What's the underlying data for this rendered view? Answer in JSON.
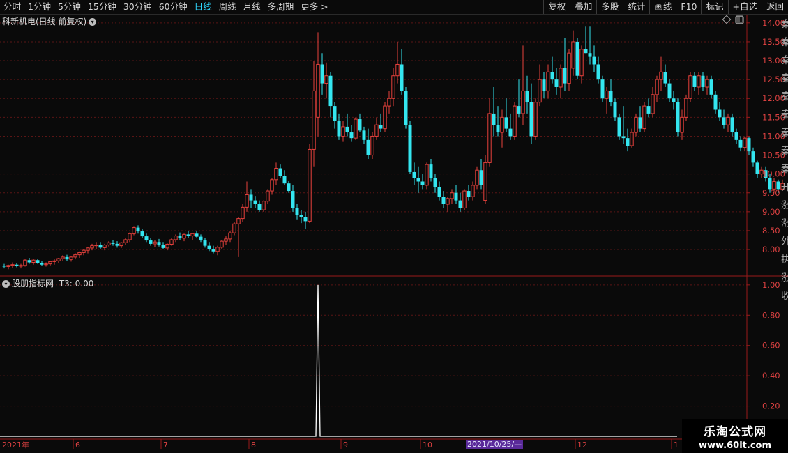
{
  "toolbar": {
    "left_items": [
      "分时",
      "1分钟",
      "5分钟",
      "15分钟",
      "30分钟",
      "60分钟",
      "日线",
      "周线",
      "月线",
      "多周期",
      "更多 >"
    ],
    "active": "日线",
    "right_items": [
      "复权",
      "叠加",
      "多股",
      "统计",
      "画线",
      "F10",
      "标记",
      "+自选",
      "返回"
    ]
  },
  "main_panel": {
    "title": "科新机电(日线 前复权)",
    "ylim": [
      7.3,
      14.2
    ]
  },
  "indicator_panel": {
    "title": "股朋指标网",
    "readout": "T3: 0.00",
    "ylim": [
      0,
      1.05
    ]
  },
  "x_axis": {
    "year_label": "2021年",
    "months": [
      "6",
      "7",
      "8",
      "9",
      "10",
      "12",
      "1"
    ],
    "cursor_date": "2021/10/25/—"
  },
  "watermark": {
    "line1": "乐淘公式网",
    "line2": "www.60lt.com"
  },
  "edge_chars": "秦秦秦秦秦秦秦秦秦开涨涨外执涨收",
  "colors": {
    "up": "#e8413c",
    "down": "#34e6f0",
    "axis": "#9a1a1a",
    "grid": "#5a1515",
    "line": "#ffffff"
  },
  "chart_data": [
    {
      "type": "candlestick",
      "title": "科新机电(日线 前复权)",
      "y_ticks": [
        8.0,
        8.5,
        9.0,
        9.5,
        10.0,
        10.5,
        11.0,
        11.5,
        12.0,
        12.5,
        13.0,
        13.5,
        14.0
      ],
      "ylim": [
        7.3,
        14.2
      ],
      "ohlc": [
        [
          7.57,
          7.62,
          7.5,
          7.55
        ],
        [
          7.55,
          7.6,
          7.48,
          7.58
        ],
        [
          7.58,
          7.66,
          7.52,
          7.6
        ],
        [
          7.6,
          7.65,
          7.53,
          7.56
        ],
        [
          7.56,
          7.62,
          7.5,
          7.58
        ],
        [
          7.58,
          7.74,
          7.55,
          7.72
        ],
        [
          7.72,
          7.78,
          7.62,
          7.66
        ],
        [
          7.66,
          7.75,
          7.6,
          7.72
        ],
        [
          7.72,
          7.76,
          7.62,
          7.64
        ],
        [
          7.64,
          7.7,
          7.56,
          7.6
        ],
        [
          7.6,
          7.66,
          7.55,
          7.62
        ],
        [
          7.62,
          7.7,
          7.58,
          7.68
        ],
        [
          7.68,
          7.74,
          7.6,
          7.7
        ],
        [
          7.7,
          7.78,
          7.64,
          7.76
        ],
        [
          7.76,
          7.85,
          7.7,
          7.8
        ],
        [
          7.8,
          7.86,
          7.7,
          7.74
        ],
        [
          7.74,
          7.82,
          7.68,
          7.8
        ],
        [
          7.8,
          7.9,
          7.74,
          7.86
        ],
        [
          7.86,
          7.95,
          7.78,
          7.92
        ],
        [
          7.92,
          8.02,
          7.85,
          7.98
        ],
        [
          7.98,
          8.06,
          7.9,
          8.04
        ],
        [
          8.04,
          8.15,
          7.98,
          8.1
        ],
        [
          8.1,
          8.2,
          8.02,
          8.12
        ],
        [
          8.12,
          8.2,
          8.0,
          8.05
        ],
        [
          8.05,
          8.15,
          7.98,
          8.12
        ],
        [
          8.12,
          8.22,
          8.08,
          8.18
        ],
        [
          8.18,
          8.25,
          8.1,
          8.15
        ],
        [
          8.15,
          8.22,
          8.05,
          8.1
        ],
        [
          8.1,
          8.2,
          8.04,
          8.18
        ],
        [
          8.18,
          8.3,
          8.12,
          8.26
        ],
        [
          8.26,
          8.45,
          8.2,
          8.42
        ],
        [
          8.42,
          8.62,
          8.38,
          8.58
        ],
        [
          8.58,
          8.64,
          8.42,
          8.48
        ],
        [
          8.48,
          8.55,
          8.3,
          8.35
        ],
        [
          8.35,
          8.42,
          8.2,
          8.24
        ],
        [
          8.24,
          8.3,
          8.1,
          8.15
        ],
        [
          8.15,
          8.24,
          8.06,
          8.2
        ],
        [
          8.2,
          8.28,
          8.08,
          8.12
        ],
        [
          8.12,
          8.2,
          8.0,
          8.04
        ],
        [
          8.04,
          8.16,
          7.98,
          8.14
        ],
        [
          8.14,
          8.3,
          8.1,
          8.26
        ],
        [
          8.26,
          8.4,
          8.2,
          8.36
        ],
        [
          8.36,
          8.45,
          8.25,
          8.3
        ],
        [
          8.3,
          8.42,
          8.22,
          8.4
        ],
        [
          8.4,
          8.5,
          8.3,
          8.36
        ],
        [
          8.36,
          8.44,
          8.26,
          8.42
        ],
        [
          8.42,
          8.5,
          8.32,
          8.34
        ],
        [
          8.34,
          8.4,
          8.2,
          8.24
        ],
        [
          8.24,
          8.3,
          8.05,
          8.1
        ],
        [
          8.1,
          8.2,
          7.96,
          8.0
        ],
        [
          8.0,
          8.1,
          7.9,
          7.95
        ],
        [
          7.95,
          8.1,
          7.85,
          8.06
        ],
        [
          8.06,
          8.26,
          8.0,
          8.22
        ],
        [
          8.22,
          8.35,
          8.12,
          8.28
        ],
        [
          8.28,
          8.48,
          8.2,
          8.44
        ],
        [
          8.44,
          8.72,
          8.38,
          8.68
        ],
        [
          8.68,
          8.85,
          7.8,
          8.82
        ],
        [
          8.82,
          9.2,
          8.72,
          9.12
        ],
        [
          9.12,
          9.8,
          9.0,
          9.45
        ],
        [
          9.45,
          9.6,
          9.1,
          9.3
        ],
        [
          9.3,
          9.42,
          9.1,
          9.2
        ],
        [
          9.2,
          9.3,
          9.0,
          9.05
        ],
        [
          9.05,
          9.3,
          9.0,
          9.28
        ],
        [
          9.28,
          9.6,
          9.2,
          9.55
        ],
        [
          9.55,
          9.9,
          9.45,
          9.85
        ],
        [
          9.85,
          10.3,
          9.7,
          10.15
        ],
        [
          10.15,
          10.25,
          9.9,
          9.95
        ],
        [
          9.95,
          10.1,
          9.7,
          9.75
        ],
        [
          9.75,
          9.82,
          9.5,
          9.55
        ],
        [
          9.55,
          9.7,
          9.0,
          9.1
        ],
        [
          9.1,
          9.2,
          8.8,
          8.92
        ],
        [
          8.92,
          9.05,
          8.7,
          8.85
        ],
        [
          8.85,
          9.0,
          8.55,
          8.75
        ],
        [
          8.75,
          10.8,
          8.7,
          10.65
        ],
        [
          10.65,
          13.0,
          10.2,
          12.2
        ],
        [
          11.5,
          13.75,
          11.0,
          12.9
        ],
        [
          12.9,
          13.2,
          12.1,
          12.4
        ],
        [
          12.4,
          12.95,
          12.0,
          12.6
        ],
        [
          12.6,
          12.7,
          11.5,
          11.8
        ],
        [
          11.8,
          11.9,
          11.2,
          11.4
        ],
        [
          11.4,
          11.6,
          10.9,
          11.0
        ],
        [
          11.0,
          11.4,
          10.85,
          11.25
        ],
        [
          11.25,
          11.6,
          11.0,
          11.1
        ],
        [
          11.1,
          11.3,
          10.85,
          10.95
        ],
        [
          10.95,
          11.5,
          10.9,
          11.45
        ],
        [
          11.45,
          11.6,
          11.1,
          11.15
        ],
        [
          11.15,
          11.25,
          10.8,
          10.9
        ],
        [
          10.9,
          11.2,
          10.4,
          10.5
        ],
        [
          10.5,
          11.1,
          10.4,
          11.0
        ],
        [
          11.0,
          11.5,
          10.9,
          11.3
        ],
        [
          11.3,
          11.6,
          11.1,
          11.2
        ],
        [
          11.2,
          11.9,
          11.1,
          11.8
        ],
        [
          11.8,
          12.2,
          11.6,
          12.0
        ],
        [
          12.0,
          12.8,
          11.8,
          12.6
        ],
        [
          12.6,
          13.5,
          12.4,
          12.9
        ],
        [
          12.9,
          13.3,
          12.1,
          12.2
        ],
        [
          12.2,
          12.3,
          11.2,
          11.3
        ],
        [
          11.3,
          11.4,
          10.0,
          10.05
        ],
        [
          10.05,
          10.3,
          9.7,
          9.9
        ],
        [
          9.9,
          10.2,
          9.5,
          9.8
        ],
        [
          9.8,
          10.0,
          9.6,
          9.7
        ],
        [
          9.7,
          10.3,
          9.6,
          10.25
        ],
        [
          10.25,
          10.4,
          9.8,
          9.9
        ],
        [
          9.9,
          10.0,
          9.5,
          9.65
        ],
        [
          9.65,
          9.8,
          9.3,
          9.4
        ],
        [
          9.4,
          9.55,
          9.1,
          9.2
        ],
        [
          9.2,
          9.4,
          9.0,
          9.35
        ],
        [
          9.35,
          9.6,
          9.2,
          9.5
        ],
        [
          9.5,
          9.7,
          9.2,
          9.3
        ],
        [
          9.3,
          9.5,
          9.0,
          9.1
        ],
        [
          9.1,
          9.6,
          9.05,
          9.55
        ],
        [
          9.55,
          9.7,
          9.3,
          9.4
        ],
        [
          9.4,
          9.8,
          9.3,
          9.7
        ],
        [
          9.7,
          10.2,
          9.6,
          10.1
        ],
        [
          10.1,
          10.4,
          9.6,
          9.7
        ],
        [
          9.3,
          10.5,
          9.2,
          10.3
        ],
        [
          10.3,
          12.0,
          10.2,
          11.6
        ],
        [
          11.6,
          12.3,
          11.0,
          11.3
        ],
        [
          11.3,
          11.8,
          11.0,
          11.1
        ],
        [
          11.1,
          11.7,
          10.7,
          11.5
        ],
        [
          11.5,
          12.0,
          11.1,
          11.2
        ],
        [
          11.2,
          11.6,
          10.9,
          11.0
        ],
        [
          11.0,
          11.9,
          10.9,
          11.8
        ],
        [
          11.8,
          12.5,
          11.5,
          11.6
        ],
        [
          11.6,
          13.4,
          11.3,
          12.2
        ],
        [
          12.2,
          12.6,
          11.6,
          11.9
        ],
        [
          11.9,
          12.4,
          10.8,
          11.0
        ],
        [
          11.0,
          12.0,
          10.9,
          11.9
        ],
        [
          11.9,
          12.9,
          11.8,
          12.5
        ],
        [
          12.5,
          12.7,
          12.0,
          12.2
        ],
        [
          12.2,
          12.9,
          12.0,
          12.7
        ],
        [
          12.7,
          13.1,
          12.4,
          12.5
        ],
        [
          12.5,
          12.8,
          12.1,
          12.3
        ],
        [
          12.3,
          12.9,
          12.0,
          12.8
        ],
        [
          12.8,
          13.6,
          12.2,
          12.4
        ],
        [
          12.4,
          13.3,
          12.2,
          13.2
        ],
        [
          12.8,
          13.8,
          12.6,
          13.5
        ],
        [
          13.5,
          13.6,
          12.5,
          12.6
        ],
        [
          12.6,
          13.4,
          12.4,
          13.3
        ],
        [
          13.3,
          13.9,
          13.2,
          13.2
        ],
        [
          13.2,
          13.9,
          12.9,
          13.1
        ],
        [
          13.1,
          13.4,
          12.7,
          12.9
        ],
        [
          12.9,
          13.1,
          12.4,
          12.5
        ],
        [
          12.5,
          12.6,
          11.9,
          12.0
        ],
        [
          12.0,
          12.3,
          11.6,
          12.2
        ],
        [
          12.2,
          12.5,
          11.8,
          11.9
        ],
        [
          11.9,
          12.0,
          11.4,
          11.5
        ],
        [
          11.5,
          11.6,
          10.9,
          11.0
        ],
        [
          11.0,
          11.8,
          10.8,
          10.95
        ],
        [
          10.95,
          11.2,
          10.6,
          10.75
        ],
        [
          10.75,
          11.2,
          10.7,
          11.1
        ],
        [
          11.1,
          11.6,
          11.0,
          11.5
        ],
        [
          11.5,
          11.8,
          11.1,
          11.2
        ],
        [
          11.2,
          11.9,
          11.1,
          11.8
        ],
        [
          11.8,
          12.0,
          11.5,
          11.6
        ],
        [
          11.6,
          12.3,
          11.5,
          12.1
        ],
        [
          12.1,
          12.6,
          11.9,
          12.5
        ],
        [
          12.5,
          13.1,
          12.2,
          12.7
        ],
        [
          12.7,
          12.9,
          12.3,
          12.4
        ],
        [
          12.4,
          12.5,
          11.9,
          12.0
        ],
        [
          12.0,
          12.2,
          11.7,
          11.9
        ],
        [
          11.9,
          12.0,
          11.0,
          11.1
        ],
        [
          11.1,
          11.7,
          10.9,
          11.5
        ],
        [
          11.5,
          12.1,
          11.4,
          12.0
        ],
        [
          12.0,
          12.7,
          11.9,
          12.6
        ],
        [
          12.6,
          12.7,
          12.2,
          12.3
        ],
        [
          12.3,
          12.7,
          12.1,
          12.6
        ],
        [
          12.6,
          12.7,
          12.2,
          12.3
        ],
        [
          12.3,
          12.6,
          12.1,
          12.5
        ],
        [
          12.5,
          12.6,
          12.0,
          12.1
        ],
        [
          12.1,
          12.2,
          11.6,
          11.7
        ],
        [
          11.7,
          11.9,
          11.4,
          11.5
        ],
        [
          11.5,
          11.7,
          11.2,
          11.3
        ],
        [
          11.3,
          11.6,
          11.1,
          11.5
        ],
        [
          11.5,
          11.6,
          11.0,
          11.1
        ],
        [
          11.1,
          11.2,
          10.8,
          10.9
        ],
        [
          10.9,
          11.0,
          10.6,
          10.7
        ],
        [
          10.7,
          11.0,
          10.6,
          10.95
        ],
        [
          10.95,
          11.0,
          10.5,
          10.6
        ],
        [
          10.6,
          10.7,
          10.2,
          10.3
        ],
        [
          10.3,
          10.35,
          9.9,
          10.0
        ],
        [
          10.0,
          10.2,
          9.9,
          10.1
        ],
        [
          10.1,
          10.2,
          9.8,
          9.9
        ],
        [
          9.9,
          10.0,
          9.5,
          9.6
        ],
        [
          9.6,
          9.9,
          9.5,
          9.8
        ],
        [
          9.8,
          9.85,
          9.5,
          9.6
        ],
        [
          9.6,
          9.85,
          9.55,
          9.75
        ]
      ]
    },
    {
      "type": "line",
      "title": "股朋指标网",
      "series": [
        {
          "name": "T3",
          "spike_index": 75,
          "spike_value": 1.0,
          "baseline": 0
        }
      ],
      "y_ticks": [
        0.2,
        0.4,
        0.6,
        0.8,
        1.0
      ],
      "ylim": [
        0,
        1.05
      ]
    }
  ]
}
